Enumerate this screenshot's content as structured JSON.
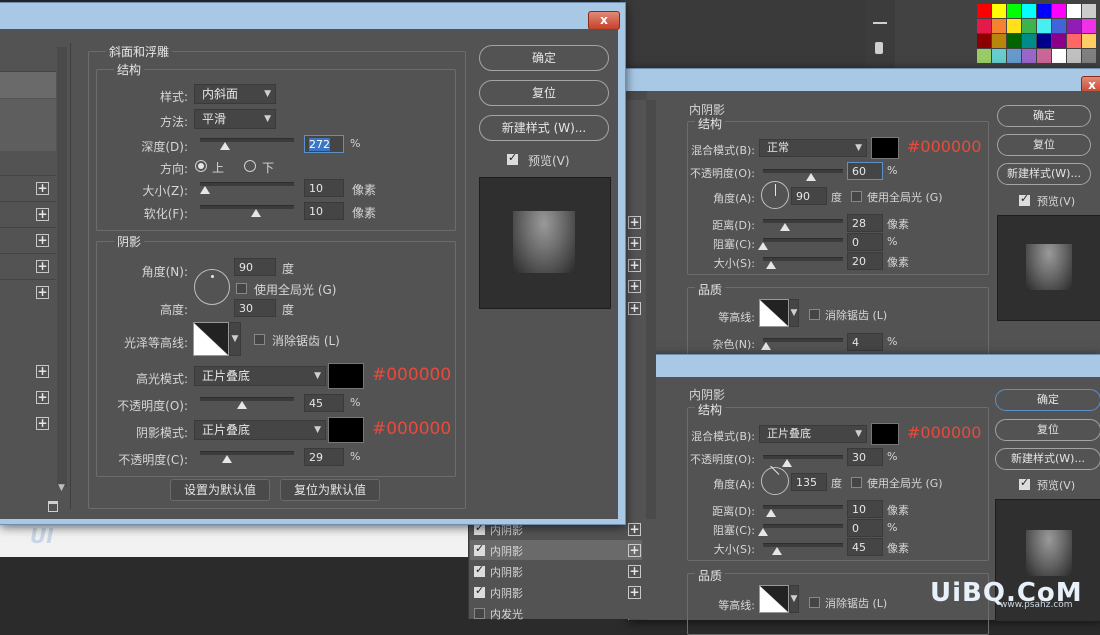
{
  "main_dialog": {
    "close_label": "x",
    "section_title": "斜面和浮雕",
    "structure_title": "结构",
    "style_label": "样式:",
    "style_value": "内斜面",
    "technique_label": "方法:",
    "technique_value": "平滑",
    "depth_label": "深度(D):",
    "depth_value": "272",
    "depth_unit": "%",
    "depth_level": 0.27,
    "direction_label": "方向:",
    "dir_up": "上",
    "dir_down": "下",
    "size_label": "大小(Z):",
    "size_value": "10",
    "size_unit": "像素",
    "size_level": 0.05,
    "soften_label": "软化(F):",
    "soften_value": "10",
    "soften_unit": "像素",
    "soften_level": 0.6,
    "shading_title": "阴影",
    "angle_label": "角度(N):",
    "angle_value": "90",
    "angle_unit": "度",
    "global_light_label": "使用全局光 (G)",
    "altitude_label": "高度:",
    "altitude_value": "30",
    "altitude_unit": "度",
    "gloss_label": "光泽等高线:",
    "antialias_label": "消除锯齿 (L)",
    "highlight_mode_label": "高光模式:",
    "highlight_mode_value": "正片叠底",
    "highlight_color": "#000000",
    "highlight_hex": "#000000",
    "highlight_opacity_label": "不透明度(O):",
    "highlight_opacity_value": "45",
    "highlight_opacity_unit": "%",
    "highlight_opacity_level": 0.45,
    "shadow_mode_label": "阴影模式:",
    "shadow_mode_value": "正片叠底",
    "shadow_color": "#000000",
    "shadow_hex": "#000000",
    "shadow_opacity_label": "不透明度(C):",
    "shadow_opacity_value": "29",
    "shadow_opacity_unit": "%",
    "shadow_opacity_level": 0.29,
    "make_default": "设置为默认值",
    "reset_default": "复位为默认值",
    "ok": "确定",
    "reset": "复位",
    "new_style": "新建样式 (W)...",
    "preview": "预览(V)"
  },
  "dialog2": {
    "close_label": "x",
    "section_title": "内阴影",
    "structure_title": "结构",
    "blend_label": "混合模式(B):",
    "blend_value": "正常",
    "color": "#000000",
    "hex": "#000000",
    "opacity_label": "不透明度(O):",
    "opacity_value": "60",
    "opacity_unit": "%",
    "opacity_level": 0.6,
    "angle_label": "角度(A):",
    "angle_value": "90",
    "angle_unit": "度",
    "global_light_label": "使用全局光 (G)",
    "distance_label": "距离(D):",
    "distance_value": "28",
    "distance_unit": "像素",
    "distance_level": 0.28,
    "choke_label": "阻塞(C):",
    "choke_value": "0",
    "choke_unit": "%",
    "choke_level": 0,
    "size_label": "大小(S):",
    "size_value": "20",
    "size_unit": "像素",
    "size_level": 0.1,
    "quality_title": "品质",
    "contour_label": "等高线:",
    "antialias_label": "消除锯齿 (L)",
    "noise_label": "杂色(N):",
    "noise_value": "4",
    "noise_unit": "%",
    "noise_level": 0.04,
    "ok": "确定",
    "reset": "复位",
    "new_style": "新建样式(W)...",
    "preview": "预览(V)"
  },
  "dialog3": {
    "section_title": "内阴影",
    "structure_title": "结构",
    "blend_label": "混合模式(B):",
    "blend_value": "正片叠底",
    "color": "#000000",
    "hex": "#000000",
    "opacity_label": "不透明度(O):",
    "opacity_value": "30",
    "opacity_unit": "%",
    "opacity_level": 0.3,
    "angle_label": "角度(A):",
    "angle_value": "135",
    "angle_unit": "度",
    "global_light_label": "使用全局光 (G)",
    "distance_label": "距离(D):",
    "distance_value": "10",
    "distance_unit": "像素",
    "distance_level": 0.1,
    "choke_label": "阻塞(C):",
    "choke_value": "0",
    "choke_unit": "%",
    "choke_level": 0,
    "size_label": "大小(S):",
    "size_value": "45",
    "size_unit": "像素",
    "size_level": 0.18,
    "quality_title": "品质",
    "contour_label": "等高线:",
    "antialias_label": "消除锯齿 (L)",
    "ok": "确定",
    "reset": "复位",
    "new_style": "新建样式(W)...",
    "preview": "预览(V)"
  },
  "effects_list": {
    "items": [
      "内阴影",
      "内阴影",
      "内阴影",
      "内发光"
    ]
  },
  "watermark": {
    "site": "UiBQ.CoM",
    "url": "www.psahz.com",
    "ui": "UI"
  },
  "palette_colors": [
    "#ff0000",
    "#ffff00",
    "#00ff00",
    "#00ffff",
    "#0000ff",
    "#ff00ff",
    "#ffffff",
    "#cccccc",
    "#e6194b",
    "#f58231",
    "#ffe119",
    "#3cb44b",
    "#46f0f0",
    "#4363d8",
    "#911eb4",
    "#f032e6",
    "#8b0000",
    "#b8860b",
    "#006400",
    "#008b8b",
    "#00008b",
    "#8b008b",
    "#ff6666",
    "#ffcc66",
    "#99cc66",
    "#66cccc",
    "#6699cc",
    "#9966cc",
    "#cc6699",
    "#ffffff",
    "#c0c0c0",
    "#808080"
  ]
}
